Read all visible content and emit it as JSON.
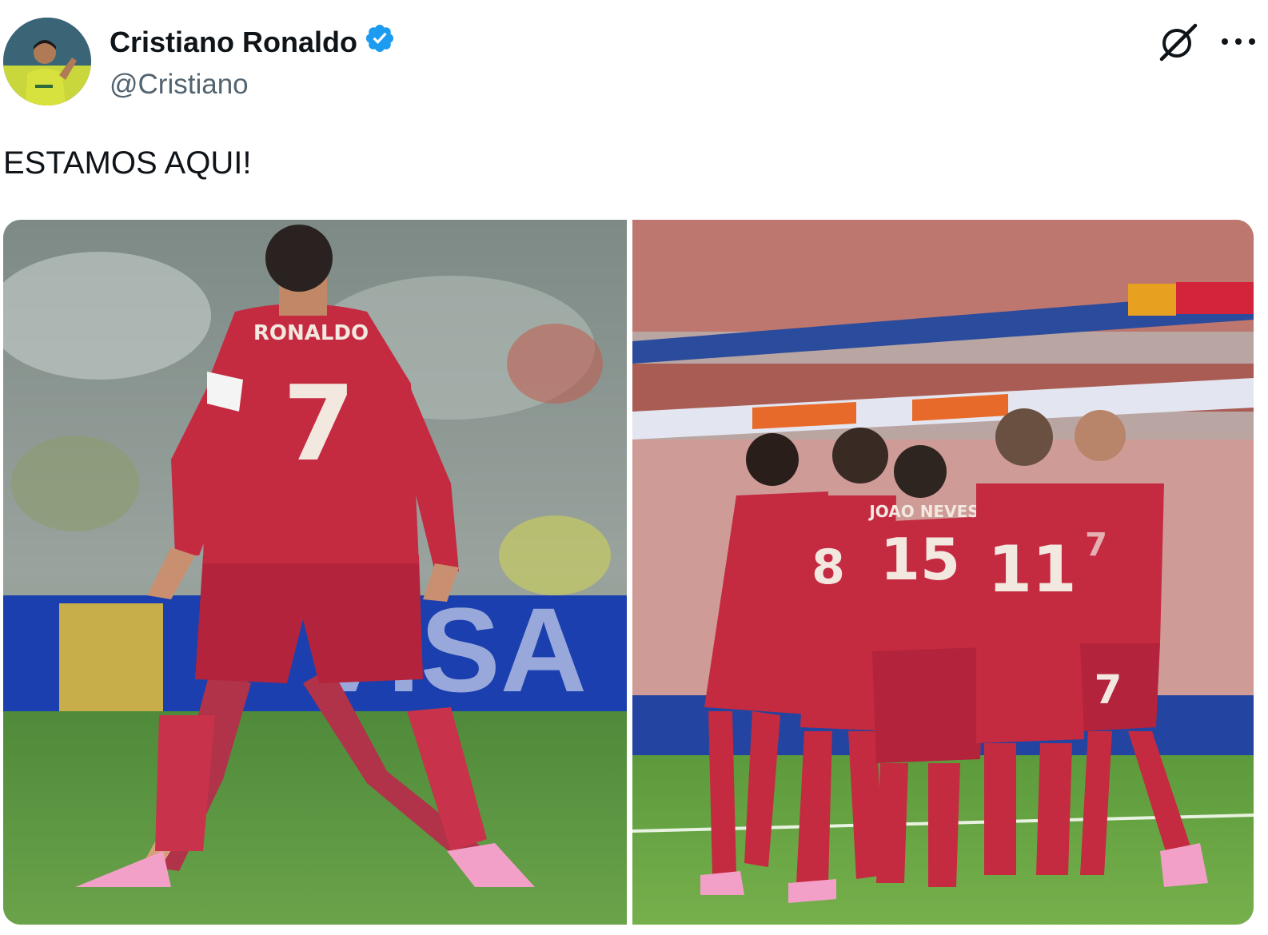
{
  "tweet": {
    "author_name": "Cristiano Ronaldo",
    "handle": "@Cristiano",
    "verified": true,
    "text": "ESTAMOS AQUI!"
  },
  "media": [
    {
      "name_on_shirt": "RONALDO",
      "number": "7",
      "board_text": "VISA"
    },
    {
      "shirt_names": [
        "JOAO NEVES"
      ],
      "numbers": [
        "15",
        "11",
        "7",
        "8",
        "7"
      ]
    }
  ],
  "icons": {
    "verified": "verified-badge-icon",
    "grok": "grok-icon",
    "more": "more-dots-icon"
  },
  "colors": {
    "verified_blue": "#1d9bf0",
    "handle_gray": "#536471",
    "text": "#0f1419"
  }
}
